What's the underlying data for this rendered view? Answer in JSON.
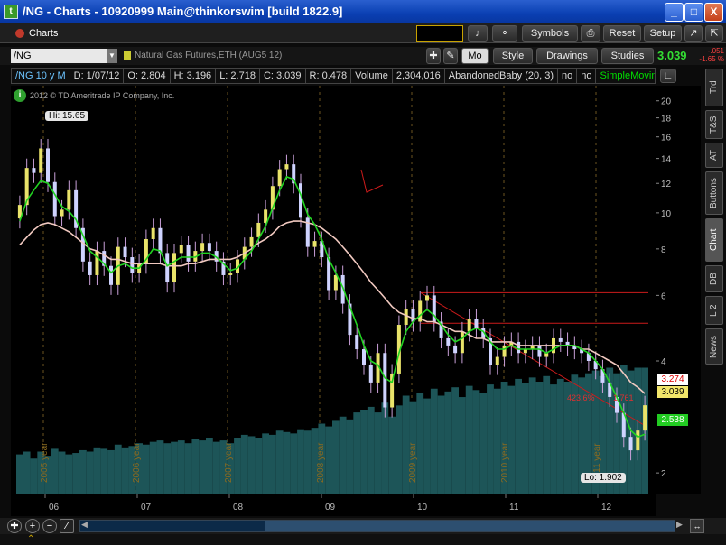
{
  "window": {
    "title": "/NG - Charts - 10920999 Main@thinkorswim [build 1822.9]",
    "app_icon": "thinkorswim-icon",
    "minimize": "_",
    "maximize": "□",
    "close": "X"
  },
  "toolbar": {
    "tab_label": "Charts",
    "symbols": "Symbols",
    "reset": "Reset",
    "setup": "Setup"
  },
  "symbar": {
    "symbol": "/NG",
    "description": "Natural Gas Futures,ETH (AUG5 12)",
    "mo": "Mo",
    "style": "Style",
    "drawings": "Drawings",
    "studies": "Studies",
    "last": "3.039",
    "change": "-.051",
    "change_pct": "-1.65 %"
  },
  "infobar": {
    "sym": "/NG 10 y M",
    "d": "D: 1/07/12",
    "o": "O: 2.804",
    "h": "H: 3.196",
    "l": "L: 2.718",
    "c": "C: 3.039",
    "r": "R: 0.478",
    "volume_label": "Volume",
    "volume": "2,304,016",
    "pattern": "AbandonedBaby (20, 3)",
    "no1": "no",
    "no2": "no",
    "study": "SimpleMovin..."
  },
  "chart_overlay": {
    "copyright": "2012 © TD Ameritrade IP Company, Inc.",
    "hi_label": "Hi: 15.65",
    "lo_label": "Lo: 1.902",
    "fib1": "423.6%",
    "fib2": "1.761",
    "price_tag_1": "3.274",
    "price_tag_2": "3.039",
    "price_tag_3": "2.538"
  },
  "colors": {
    "up": "#e9e36a",
    "down": "#cfd3ff",
    "volume": "#1d5558",
    "ma_fast": "#21d321",
    "ma_slow": "#f1c9c0",
    "resistance": "#cc1b1b"
  },
  "chart_data": {
    "type": "line",
    "title": "",
    "scale": "log",
    "yaxis_ticks": [
      "20",
      "18",
      "16",
      "14",
      "12",
      "10",
      "8",
      "6",
      "4",
      "2"
    ],
    "xaxis_ticks": [
      "06",
      "07",
      "08",
      "09",
      "10",
      "11",
      "12"
    ],
    "year_markers": [
      "2005 year",
      "2006 year",
      "2007 year",
      "2008 year",
      "2009 year",
      "2010 year",
      "2011 year"
    ],
    "ylim": [
      1.8,
      21
    ],
    "series": [
      {
        "values": [
          10.5,
          13.2,
          12.8,
          14.9,
          12.1,
          9.8,
          10.2,
          11.5,
          9.1,
          7.4,
          6.8,
          7.9,
          7.2,
          6.4,
          8.1,
          7.6,
          6.9,
          7.3,
          8.5,
          9.1,
          7.8,
          6.5,
          7.8,
          8.2,
          7.4,
          7.9,
          8.3,
          7.9,
          7.4,
          6.8,
          6.9,
          7.5,
          8.1,
          8.6,
          9.4,
          10.2,
          11.8,
          13.1,
          13.5,
          12.0,
          9.7,
          8.1,
          8.4,
          7.6,
          6.2,
          6.8,
          5.7,
          4.7,
          4.3,
          3.9,
          3.5,
          4.2,
          3.0,
          3.7,
          5.0,
          5.5,
          5.1,
          5.8,
          6.0,
          5.1,
          4.6,
          4.4,
          4.2,
          4.8,
          5.2,
          4.9,
          4.6,
          3.9,
          4.1,
          4.4,
          4.5,
          4.2,
          4.3,
          4.4,
          4.1,
          4.2,
          4.6,
          4.5,
          4.4,
          4.3,
          4.2,
          4.0,
          3.8,
          3.5,
          3.2,
          2.9,
          2.5,
          2.3,
          2.6,
          3.04
        ]
      },
      {
        "values": [
          9.5,
          10.8,
          11.5,
          12.2,
          12.0,
          11.2,
          10.4,
          10.1,
          9.6,
          8.7,
          7.9,
          7.6,
          7.3,
          6.9,
          7.2,
          7.3,
          7.1,
          7.1,
          7.5,
          8.0,
          7.9,
          7.2,
          7.4,
          7.6,
          7.6,
          7.6,
          7.8,
          7.8,
          7.6,
          7.3,
          7.0,
          7.1,
          7.5,
          7.9,
          8.5,
          9.2,
          10.3,
          11.5,
          12.5,
          12.3,
          11.2,
          9.9,
          9.3,
          8.5,
          7.5,
          6.9,
          6.3,
          5.6,
          5.0,
          4.4,
          4.0,
          3.9,
          3.6,
          3.5,
          4.2,
          4.8,
          5.1,
          5.3,
          5.5,
          5.3,
          5.0,
          4.7,
          4.5,
          4.6,
          4.8,
          4.9,
          4.8,
          4.5,
          4.3,
          4.3,
          4.4,
          4.3,
          4.3,
          4.3,
          4.3,
          4.2,
          4.3,
          4.4,
          4.4,
          4.4,
          4.3,
          4.2,
          4.0,
          3.8,
          3.5,
          3.2,
          2.9,
          2.6,
          2.5,
          2.54
        ]
      },
      {
        "values": [
          8.2,
          8.6,
          9.0,
          9.3,
          9.4,
          9.3,
          9.1,
          8.9,
          8.6,
          8.3,
          8.0,
          7.9,
          7.7,
          7.5,
          7.5,
          7.4,
          7.3,
          7.3,
          7.3,
          7.3,
          7.3,
          7.2,
          7.2,
          7.2,
          7.3,
          7.3,
          7.4,
          7.5,
          7.5,
          7.5,
          7.5,
          7.6,
          7.8,
          8.0,
          8.3,
          8.5,
          8.8,
          9.2,
          9.4,
          9.5,
          9.5,
          9.4,
          9.3,
          9.1,
          8.8,
          8.5,
          8.1,
          7.7,
          7.3,
          6.9,
          6.5,
          6.2,
          5.9,
          5.6,
          5.4,
          5.3,
          5.2,
          5.2,
          5.1,
          5.1,
          5.0,
          4.9,
          4.8,
          4.8,
          4.7,
          4.6,
          4.6,
          4.5,
          4.5,
          4.5,
          4.5,
          4.4,
          4.4,
          4.4,
          4.4,
          4.4,
          4.4,
          4.4,
          4.4,
          4.4,
          4.3,
          4.3,
          4.2,
          4.1,
          4.0,
          3.9,
          3.7,
          3.5,
          3.4,
          3.27
        ]
      }
    ],
    "volume": [
      0.28,
      0.3,
      0.25,
      0.3,
      0.27,
      0.32,
      0.3,
      0.28,
      0.29,
      0.31,
      0.3,
      0.33,
      0.32,
      0.31,
      0.35,
      0.33,
      0.34,
      0.36,
      0.35,
      0.37,
      0.38,
      0.36,
      0.37,
      0.38,
      0.36,
      0.39,
      0.38,
      0.4,
      0.37,
      0.38,
      0.36,
      0.4,
      0.42,
      0.41,
      0.4,
      0.43,
      0.42,
      0.45,
      0.44,
      0.43,
      0.46,
      0.45,
      0.47,
      0.5,
      0.48,
      0.52,
      0.55,
      0.53,
      0.58,
      0.6,
      0.62,
      0.58,
      0.65,
      0.55,
      0.63,
      0.7,
      0.66,
      0.72,
      0.68,
      0.75,
      0.7,
      0.73,
      0.76,
      0.69,
      0.77,
      0.74,
      0.72,
      0.78,
      0.75,
      0.8,
      0.77,
      0.82,
      0.79,
      0.83,
      0.8,
      0.84,
      0.78,
      0.82,
      0.8,
      0.85,
      0.83,
      0.86,
      0.88,
      0.84,
      0.9,
      0.86,
      0.92,
      0.88,
      0.9,
      0.9
    ]
  },
  "sidetabs": [
    "Trd",
    "T&S",
    "AT",
    "Buttons",
    "Chart",
    "DB",
    "L 2",
    "News"
  ]
}
